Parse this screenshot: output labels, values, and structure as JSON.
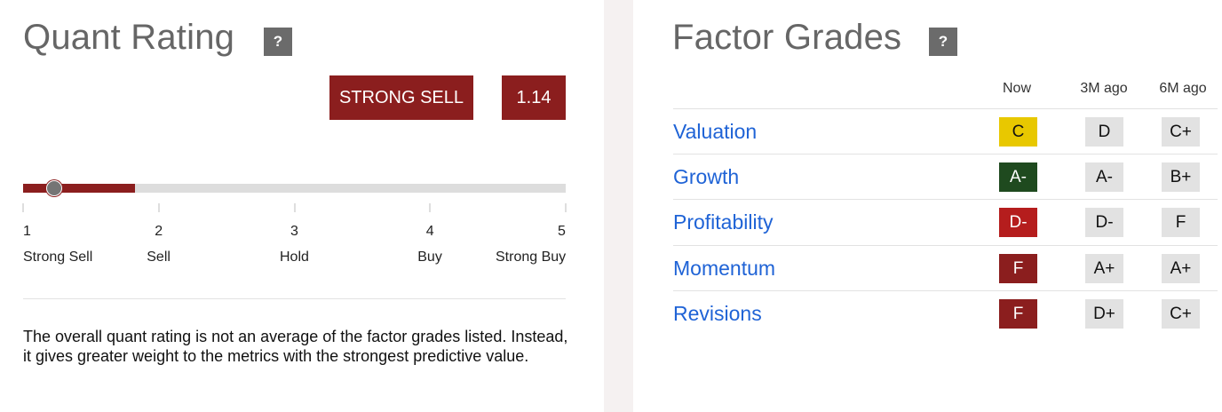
{
  "quant": {
    "title": "Quant Rating",
    "help_label": "?",
    "rating_label": "STRONG SELL",
    "rating_value": "1.14",
    "rating_numeric": 1.14,
    "scale_min": 1,
    "scale_max": 5,
    "scale": [
      {
        "num": "1",
        "label": "Strong Sell"
      },
      {
        "num": "2",
        "label": "Sell"
      },
      {
        "num": "3",
        "label": "Hold"
      },
      {
        "num": "4",
        "label": "Buy"
      },
      {
        "num": "5",
        "label": "Strong Buy"
      }
    ],
    "note": "The overall quant rating is not an average of the factor grades listed. Instead, it gives greater weight to the metrics with the strongest predictive value."
  },
  "factors": {
    "title": "Factor Grades",
    "help_label": "?",
    "columns": [
      "Now",
      "3M ago",
      "6M ago"
    ],
    "rows": [
      {
        "name": "Valuation",
        "now": "C",
        "m3": "D",
        "m6": "C+",
        "now_bg": "#e8c800",
        "now_fg": "#111111"
      },
      {
        "name": "Growth",
        "now": "A-",
        "m3": "A-",
        "m6": "B+",
        "now_bg": "#1f4a1f",
        "now_fg": "#ffffff"
      },
      {
        "name": "Profitability",
        "now": "D-",
        "m3": "D-",
        "m6": "F",
        "now_bg": "#b51d1d",
        "now_fg": "#ffffff"
      },
      {
        "name": "Momentum",
        "now": "F",
        "m3": "A+",
        "m6": "A+",
        "now_bg": "#8b1e1e",
        "now_fg": "#ffffff"
      },
      {
        "name": "Revisions",
        "now": "F",
        "m3": "D+",
        "m6": "C+",
        "now_bg": "#8b1e1e",
        "now_fg": "#ffffff"
      }
    ]
  },
  "colors": {
    "accent_dark_red": "#8b1e1e",
    "link_blue": "#1f63d6",
    "panel_gap": "#f5f1f1"
  }
}
